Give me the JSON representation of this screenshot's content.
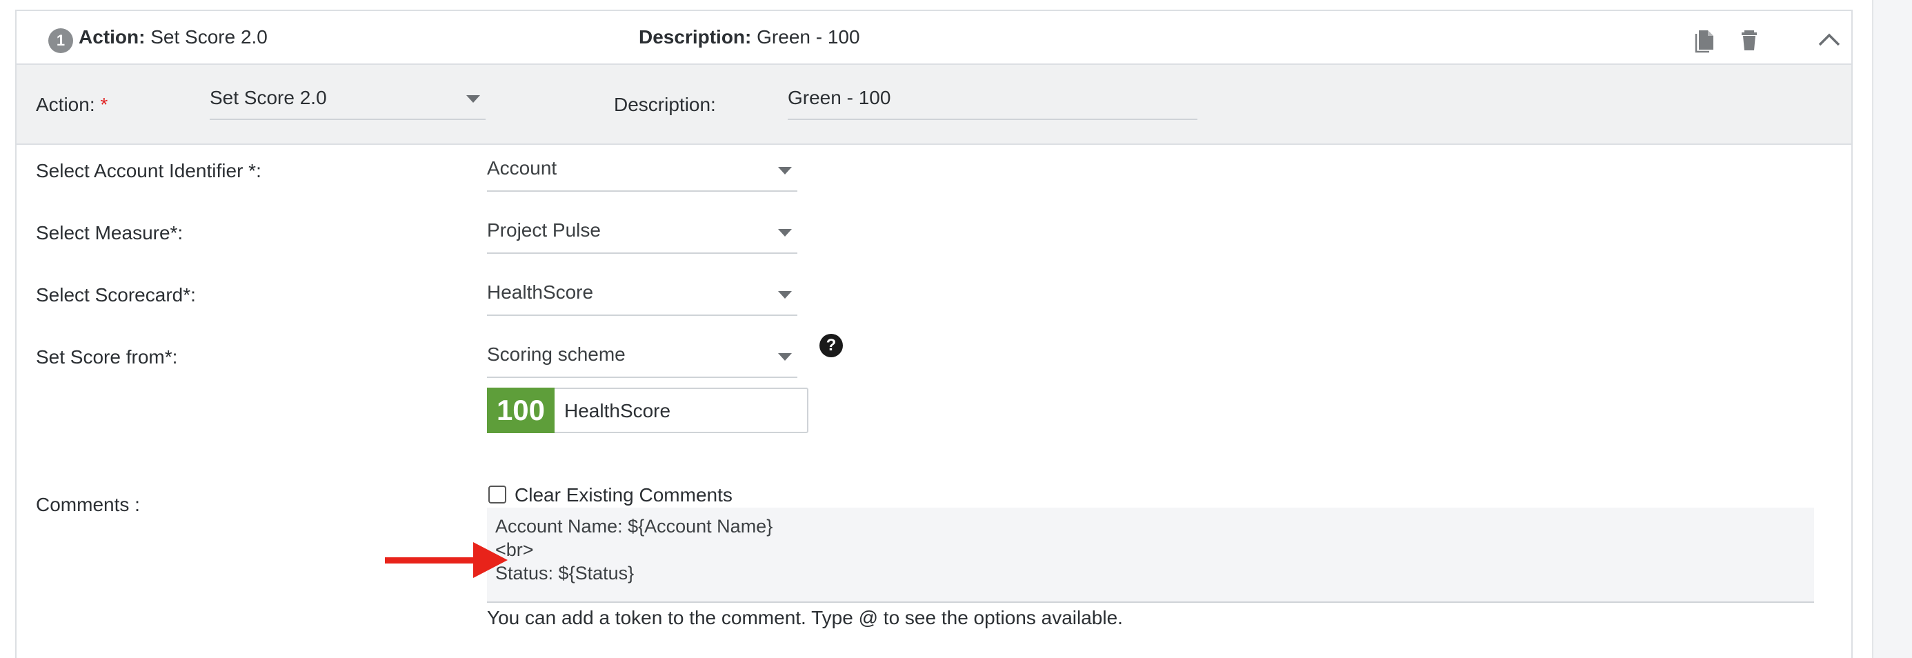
{
  "header": {
    "step_number": "1",
    "action_label": "Action:",
    "action_value": "Set Score 2.0",
    "description_label": "Description:",
    "description_value": "Green - 100",
    "icons": [
      "copy-icon",
      "trash-icon",
      "chevron-up-icon"
    ]
  },
  "subbar": {
    "action_label": "Action:",
    "required_mark": "*",
    "action_value": "Set Score 2.0",
    "description_label": "Description:",
    "description_value": "Green - 100"
  },
  "form": {
    "account_identifier": {
      "label": "Select Account Identifier *:",
      "value": "Account"
    },
    "measure": {
      "label": "Select Measure*:",
      "value": "Project Pulse"
    },
    "scorecard": {
      "label": "Select Scorecard*:",
      "value": "HealthScore"
    },
    "score_from": {
      "label": "Set Score from*:",
      "value": "Scoring scheme",
      "help": "?"
    },
    "score": {
      "number": "100",
      "name": "HealthScore",
      "color": "#5e9e3a"
    },
    "comments": {
      "label": "Comments :",
      "clear_label": "Clear Existing Comments",
      "clear_checked": false,
      "lines": [
        "Account Name: ${Account Name}",
        "<br>",
        "Status: ${Status}"
      ],
      "hint": "You can add a token to the comment. Type @ to see the options available."
    }
  },
  "colors": {
    "accent_arrow": "#e8231a",
    "score_green": "#5e9e3a"
  }
}
